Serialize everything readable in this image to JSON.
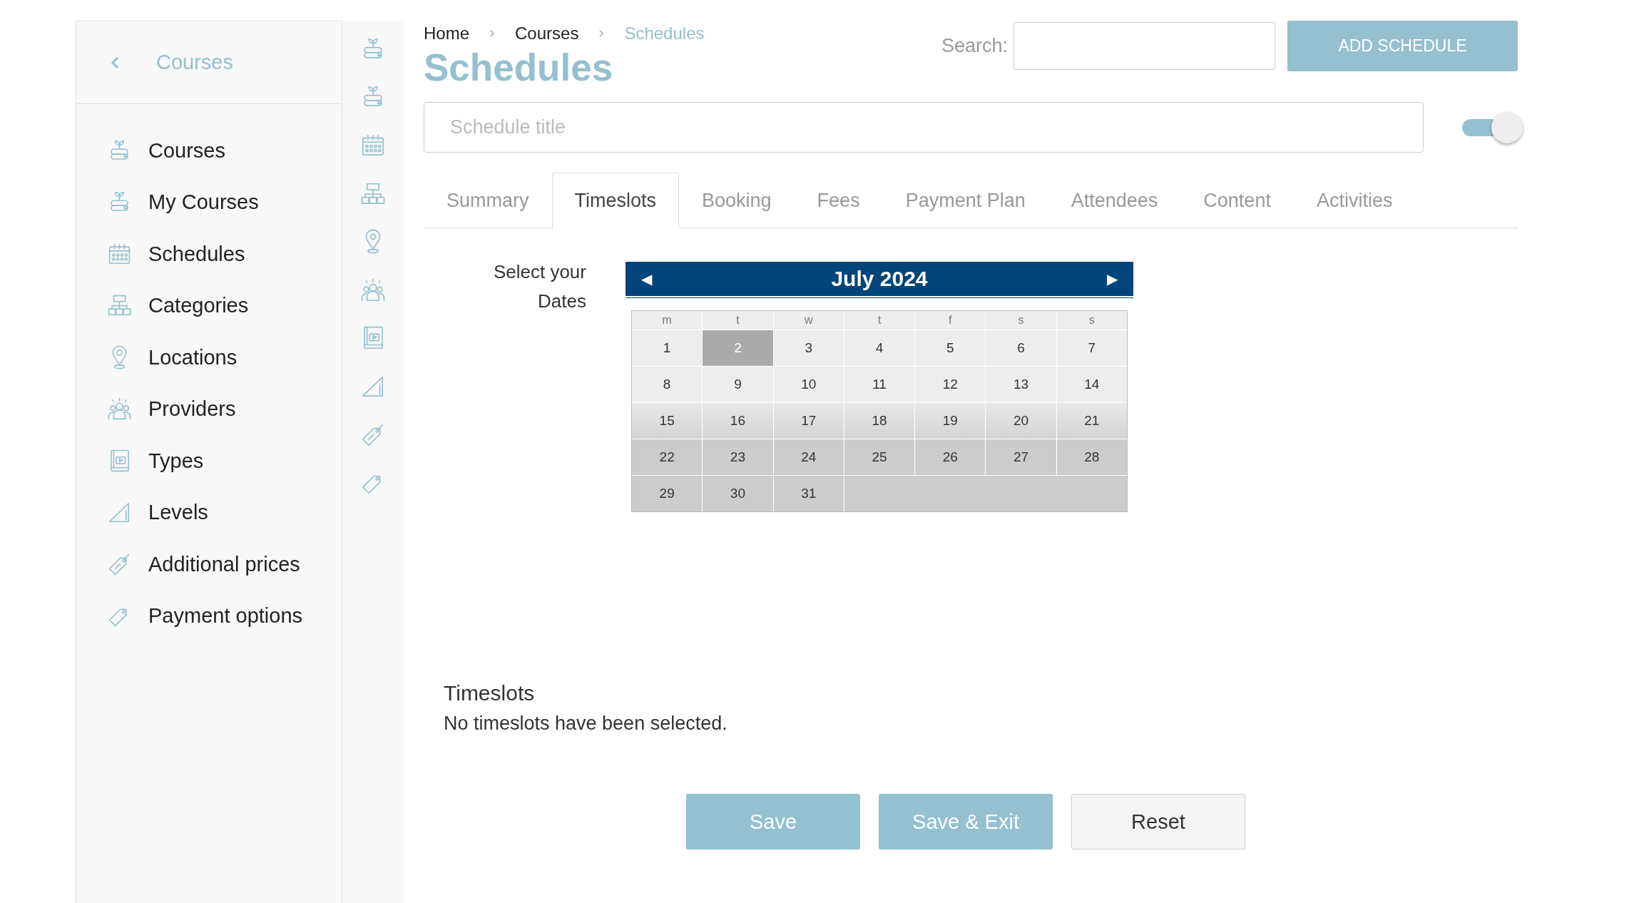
{
  "sidebar": {
    "back_label": "Courses",
    "items": [
      {
        "label": "Courses"
      },
      {
        "label": "My Courses"
      },
      {
        "label": "Schedules"
      },
      {
        "label": "Categories"
      },
      {
        "label": "Locations"
      },
      {
        "label": "Providers"
      },
      {
        "label": "Types"
      },
      {
        "label": "Levels"
      },
      {
        "label": "Additional prices"
      },
      {
        "label": "Payment options"
      }
    ]
  },
  "breadcrumb": [
    {
      "label": "Home",
      "current": false
    },
    {
      "label": "Courses",
      "current": false
    },
    {
      "label": "Schedules",
      "current": true
    }
  ],
  "page_title": "Schedules",
  "search": {
    "label": "Search:"
  },
  "add_button": "ADD SCHEDULE",
  "title_field": {
    "placeholder": "Schedule title"
  },
  "toggle": {
    "on": true
  },
  "tabs": [
    {
      "label": "Summary",
      "selected": false
    },
    {
      "label": "Timeslots",
      "selected": true
    },
    {
      "label": "Booking",
      "selected": false
    },
    {
      "label": "Fees",
      "selected": false
    },
    {
      "label": "Payment Plan",
      "selected": false
    },
    {
      "label": "Attendees",
      "selected": false
    },
    {
      "label": "Content",
      "selected": false
    },
    {
      "label": "Activities",
      "selected": false
    }
  ],
  "date_picker": {
    "label_lines": [
      "Select your",
      "Dates"
    ],
    "prev": "◀",
    "next": "▶",
    "month": "July 2024",
    "weekdays": [
      "m",
      "t",
      "w",
      "t",
      "f",
      "s",
      "s"
    ],
    "weeks": [
      [
        {
          "day": "1",
          "selected": false
        },
        {
          "day": "2",
          "selected": true
        },
        {
          "day": "3",
          "selected": false
        },
        {
          "day": "4",
          "selected": false
        },
        {
          "day": "5",
          "selected": false
        },
        {
          "day": "6",
          "selected": false
        },
        {
          "day": "7",
          "selected": false
        }
      ],
      [
        {
          "day": "8",
          "selected": false
        },
        {
          "day": "9",
          "selected": false
        },
        {
          "day": "10",
          "selected": false
        },
        {
          "day": "11",
          "selected": false
        },
        {
          "day": "12",
          "selected": false
        },
        {
          "day": "13",
          "selected": false
        },
        {
          "day": "14",
          "selected": false
        }
      ],
      [
        {
          "day": "15",
          "selected": false
        },
        {
          "day": "16",
          "selected": false
        },
        {
          "day": "17",
          "selected": false
        },
        {
          "day": "18",
          "selected": false
        },
        {
          "day": "19",
          "selected": false
        },
        {
          "day": "20",
          "selected": false
        },
        {
          "day": "21",
          "selected": false
        }
      ],
      [
        {
          "day": "22",
          "selected": false
        },
        {
          "day": "23",
          "selected": false
        },
        {
          "day": "24",
          "selected": false
        },
        {
          "day": "25",
          "selected": false
        },
        {
          "day": "26",
          "selected": false
        },
        {
          "day": "27",
          "selected": false
        },
        {
          "day": "28",
          "selected": false
        }
      ],
      [
        {
          "day": "29",
          "selected": false
        },
        {
          "day": "30",
          "selected": false
        },
        {
          "day": "31",
          "selected": false
        }
      ]
    ]
  },
  "timeslots": {
    "heading": "Timeslots",
    "message": "No timeslots have been selected."
  },
  "buttons": [
    {
      "label": "Save",
      "kind": "primary"
    },
    {
      "label": "Save & Exit",
      "kind": "primary"
    },
    {
      "label": "Reset",
      "kind": "secondary"
    }
  ]
}
